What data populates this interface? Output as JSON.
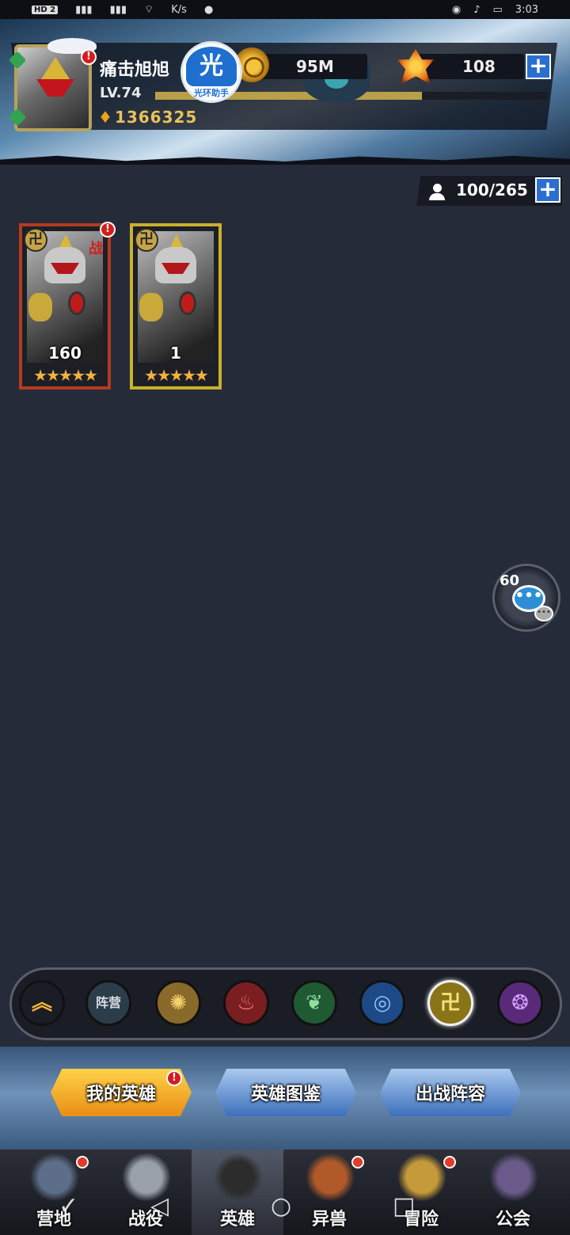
{
  "status_bar": {
    "hd_badge": "HD 2",
    "net_speed": "K/s",
    "time": "3:03"
  },
  "player": {
    "name": "痛击旭旭",
    "level": "LV.74",
    "power": "1366325",
    "xp_fraction": 0.68,
    "avatar_alert": "!"
  },
  "helper_badge": {
    "glyph": "光",
    "caption": "光环助手"
  },
  "resources": {
    "gold": "95M",
    "gems": "108",
    "plus": "+"
  },
  "hero_capacity": "100/265",
  "heroes": [
    {
      "level": "160",
      "stars": "★★★★★",
      "tag": "战",
      "emblem": "卍",
      "frame_color": "#b33a20",
      "has_alert": true
    },
    {
      "level": "1",
      "stars": "★★★★★",
      "tag": "",
      "emblem": "卍",
      "frame_color": "#c9b12a",
      "has_alert": false
    }
  ],
  "chat": {
    "count": "60",
    "icon": "chat-bubble-icon"
  },
  "filters": [
    {
      "label": "",
      "icon": "chevron-up-icon",
      "color": "#1a1d26",
      "text_color": "#f4b63a"
    },
    {
      "label": "阵营",
      "icon": "camp-filter",
      "color": "#2c3d4a",
      "text_color": "#d7dde3"
    },
    {
      "label": "✺",
      "icon": "sun-faction-icon",
      "color": "#8a6a2a",
      "text_color": "#f7d06a"
    },
    {
      "label": "♨",
      "icon": "fire-faction-icon",
      "color": "#7a1e22",
      "text_color": "#ff7a6a"
    },
    {
      "label": "❦",
      "icon": "nature-faction-icon",
      "color": "#1f5a33",
      "text_color": "#8fe0a0"
    },
    {
      "label": "◎",
      "icon": "water-faction-icon",
      "color": "#1d4a86",
      "text_color": "#8fc4ff"
    },
    {
      "label": "卍",
      "icon": "light-faction-icon",
      "color": "#8a7418",
      "text_color": "#f4e07a"
    },
    {
      "label": "❂",
      "icon": "shadow-faction-icon",
      "color": "#5a2a7a",
      "text_color": "#d39cff"
    }
  ],
  "actions": {
    "my_heroes": "我的英雄",
    "hero_codex": "英雄图鉴",
    "battle_lineup": "出战阵容",
    "alert": "!"
  },
  "nav": [
    {
      "label": "营地",
      "icon": "camp-tower-icon",
      "dot": true
    },
    {
      "label": "战役",
      "icon": "crossed-swords-icon",
      "dot": false
    },
    {
      "label": "英雄",
      "icon": "knight-helmet-icon",
      "dot": false
    },
    {
      "label": "异兽",
      "icon": "beast-icon",
      "dot": true
    },
    {
      "label": "冒险",
      "icon": "compass-icon",
      "dot": true
    },
    {
      "label": "公会",
      "icon": "guild-scroll-icon",
      "dot": false
    }
  ],
  "system_nav": {
    "back": "◁",
    "home": "○",
    "recents": "□",
    "collapse": "✓"
  }
}
